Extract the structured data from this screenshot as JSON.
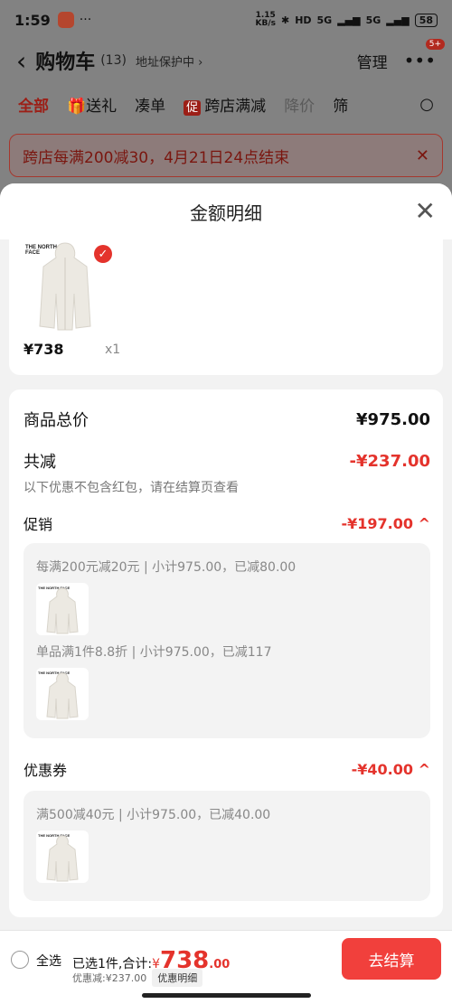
{
  "status": {
    "time": "1:59",
    "dots": "···",
    "net": "1.15\nKB/s",
    "battery": "58",
    "hd": "HD",
    "sig5g_a": "5G",
    "sig5g_b": "5G"
  },
  "nav": {
    "back": "‹",
    "title": "购物车",
    "count": "(13)",
    "address": "地址保护中 ›",
    "manage": "管理",
    "more": "•••",
    "badge": "5+"
  },
  "tabs": [
    {
      "label": "全部"
    },
    {
      "label": "送礼"
    },
    {
      "label": "凑单"
    },
    {
      "label": "跨店满减",
      "tag": "促"
    },
    {
      "label": "降价"
    },
    {
      "label": "筛选"
    }
  ],
  "banner": {
    "text": "跨店每满200减30，4月21日24点结束",
    "close": "✕"
  },
  "sheet": {
    "title": "金额明细",
    "close": "✕"
  },
  "product": {
    "brand": "THE NORTH FACE",
    "price": "¥738",
    "qty": "x1",
    "check": "✓"
  },
  "details": {
    "total_label": "商品总价",
    "total_value": "¥975.00",
    "discount_label": "共减",
    "discount_value": "-¥237.00",
    "note": "以下优惠不包含红包，请在结算页查看",
    "promo_label": "促销",
    "promo_value": "-¥197.00 ^",
    "promo_rules": [
      "每满200元减20元 | 小计975.00，已减80.00",
      "单品满1件8.8折 | 小计975.00，已减117"
    ],
    "coupon_label": "优惠券",
    "coupon_value": "-¥40.00 ^",
    "coupon_rules": [
      "满500减40元 | 小计975.00，已减40.00"
    ]
  },
  "bottom": {
    "select_all": "全选",
    "summary_prefix": "已选1件,合计:",
    "yen": "¥",
    "total_int": "738",
    "total_dec": ".00",
    "saved": "优惠减:¥237.00",
    "detail_btn": "优惠明细",
    "checkout": "去结算"
  },
  "colors": {
    "accent": "#e4332c",
    "checkout": "#f1403c"
  }
}
